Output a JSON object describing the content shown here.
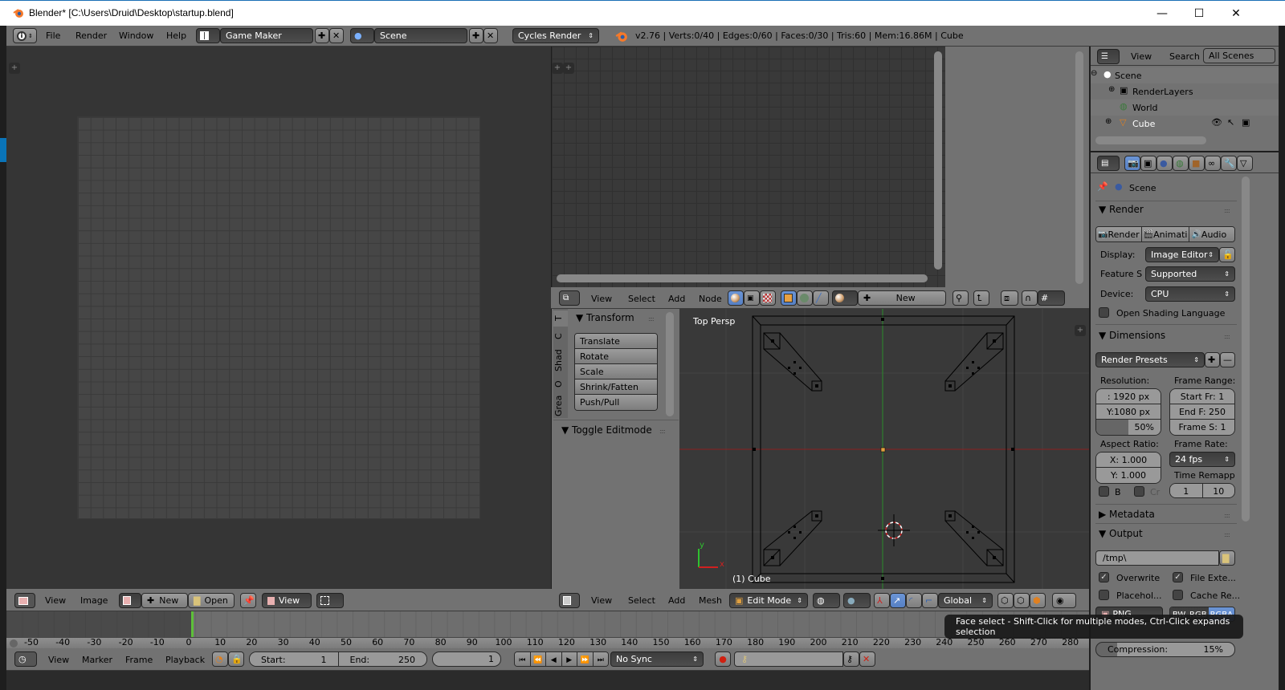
{
  "window": {
    "title": "Blender* [C:\\Users\\Druid\\Desktop\\startup.blend]",
    "controls": {
      "minimize": "—",
      "maximize": "☐",
      "close": "✕"
    }
  },
  "topbar": {
    "menus": [
      "File",
      "Render",
      "Window",
      "Help"
    ],
    "screen_layout": "Game Maker",
    "scene": "Scene",
    "render_engine": "Cycles Render",
    "stats": "v2.76 | Verts:0/40 | Edges:0/60 | Faces:0/30 | Tris:60 | Mem:16.86M | Cube"
  },
  "image_editor": {
    "header_menus": [
      "View",
      "Image"
    ],
    "new_label": "New",
    "open_label": "Open",
    "view_label": "View"
  },
  "node_editor": {
    "header_menus": [
      "View",
      "Select",
      "Add",
      "Node"
    ],
    "new_label": "New"
  },
  "viewport": {
    "label": "Top Persp",
    "object_label": "(1) Cube",
    "axis_x": "x",
    "axis_y": "y",
    "header_menus": [
      "View",
      "Select",
      "Add",
      "Mesh"
    ],
    "mode": "Edit Mode",
    "orientation": "Global"
  },
  "toolshelf": {
    "tabs": [
      "T",
      "C",
      "Shad",
      "O",
      "Grea"
    ],
    "transform_title": "Transform",
    "transform_buttons": [
      "Translate",
      "Rotate",
      "Scale",
      "Shrink/Fatten",
      "Push/Pull"
    ],
    "toggle_title": "Toggle Editmode"
  },
  "outliner": {
    "view_label": "View",
    "search_label": "Search",
    "filter": "All Scenes",
    "items": [
      {
        "label": "Scene",
        "icon": "scene-icon"
      },
      {
        "label": "RenderLayers",
        "icon": "render-layers-icon"
      },
      {
        "label": "World",
        "icon": "world-icon"
      },
      {
        "label": "Cube",
        "icon": "mesh-object-icon"
      }
    ]
  },
  "properties": {
    "context": "Scene",
    "render": {
      "title": "Render",
      "tabs": [
        "Render",
        "Animati",
        "Audio"
      ],
      "display_label": "Display:",
      "display_value": "Image Editor",
      "feature_label": "Feature S",
      "feature_value": "Supported",
      "device_label": "Device:",
      "device_value": "CPU",
      "osl_label": "Open Shading Language",
      "osl_checked": false
    },
    "dimensions": {
      "title": "Dimensions",
      "presets": "Render Presets",
      "resolution_label": "Resolution:",
      "res_x": ": 1920 px",
      "res_y": "Y:1080 px",
      "res_pct": "50%",
      "res_pct_value": 50,
      "frame_range_label": "Frame Range:",
      "start": "Start Fr:  1",
      "end": "End F: 250",
      "step": "Frame S: 1",
      "aspect_label": "Aspect Ratio:",
      "aspect_x": "X:    1.000",
      "aspect_y": "Y:    1.000",
      "frame_rate_label": "Frame Rate:",
      "fps": "24 fps",
      "time_remap_label": "Time Remapp",
      "remap_old": "1",
      "remap_new": "10",
      "border_label": "B",
      "crop_label": "Cr"
    },
    "metadata_title": "Metadata",
    "output": {
      "title": "Output",
      "path": "/tmp\\",
      "overwrite": "Overwrite",
      "file_ext": "File Exte...",
      "placeholders": "Placehol...",
      "cache": "Cache Re...",
      "format": "PNG",
      "color_modes": [
        "BW",
        "RGB",
        "RGBA"
      ],
      "compression_label": "Compression:",
      "compression_value": "15%",
      "compression_pct": 15
    }
  },
  "tooltip": "Face select - Shift-Click for multiple modes, Ctrl-Click expands selection",
  "timeline": {
    "ticks": [
      "-50",
      "-40",
      "-30",
      "-20",
      "-10",
      "0",
      "10",
      "20",
      "30",
      "40",
      "50",
      "60",
      "70",
      "80",
      "90",
      "100",
      "110",
      "120",
      "130",
      "140",
      "150",
      "160",
      "170",
      "180",
      "190",
      "200",
      "210",
      "220",
      "230",
      "240",
      "250",
      "260",
      "270",
      "280"
    ],
    "current_frame": 1,
    "header_menus": [
      "View",
      "Marker",
      "Frame",
      "Playback"
    ],
    "start_label": "Start:",
    "start_value": "1",
    "end_label": "End:",
    "end_value": "250",
    "frame_value": "1",
    "sync": "No Sync"
  }
}
